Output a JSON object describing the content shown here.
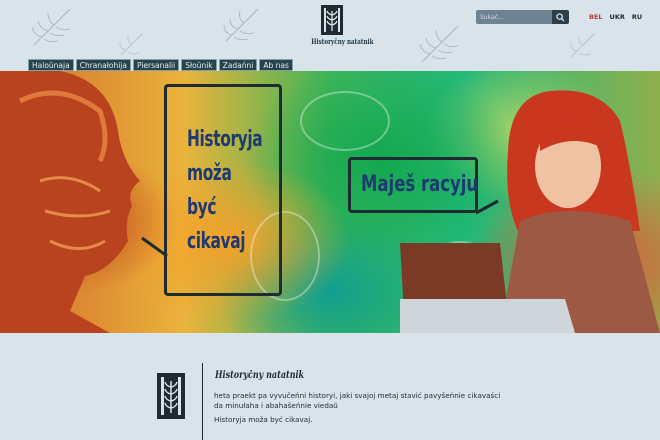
{
  "header": {
    "site_name": "Historyčny natatnik",
    "search": {
      "placeholder": "Šukać..."
    },
    "languages": [
      {
        "label": "BEL",
        "active": true
      },
      {
        "label": "UKR",
        "active": false
      },
      {
        "label": "RU",
        "active": false
      }
    ]
  },
  "nav": {
    "items": [
      "Haloŭnaja",
      "Chranałohija",
      "Piersanalii",
      "Słoŭnik",
      "Zadańni",
      "Ab nas"
    ]
  },
  "hero": {
    "bubble_left": "Historyja\nmoža\nbyć\ncikavaj",
    "bubble_right": "Maješ racyju"
  },
  "footer": {
    "title": "Historyčny natatnik",
    "description": "heta praekt pa vyvučeńni historyi, jaki svajoj metaj stavić pavyšeńnie cikavaści da minułaha i abahašeńnie viedaŭ",
    "tagline": "Historyja moža być cikavaj."
  },
  "colors": {
    "accent": "#c0392b",
    "nav_bg": "#28434c",
    "text_dark": "#1e2b30",
    "bubble_text": "#1f3a70"
  }
}
